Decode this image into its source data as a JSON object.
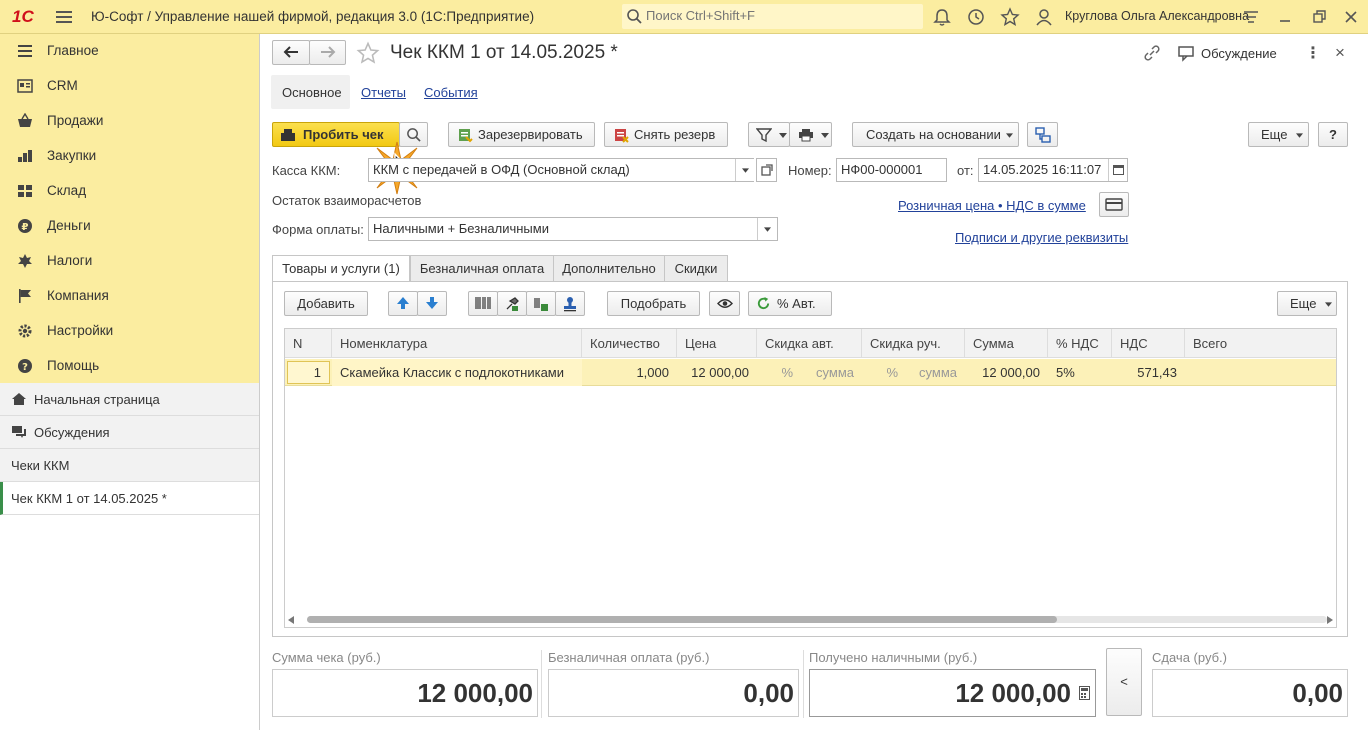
{
  "titlebar": {
    "logo": "1С",
    "title": "Ю-Софт / Управление нашей фирмой, редакция 3.0  (1С:Предприятие)",
    "search_placeholder": "Поиск Ctrl+Shift+F",
    "user": "Круглова Ольга Александровна"
  },
  "sidebar": {
    "sections": [
      {
        "label": "Главное",
        "icon": "menu-icon"
      },
      {
        "label": "CRM",
        "icon": "crm-icon"
      },
      {
        "label": "Продажи",
        "icon": "basket-icon"
      },
      {
        "label": "Закупки",
        "icon": "purchases-icon"
      },
      {
        "label": "Склад",
        "icon": "warehouse-icon"
      },
      {
        "label": "Деньги",
        "icon": "money-icon"
      },
      {
        "label": "Налоги",
        "icon": "taxes-icon"
      },
      {
        "label": "Компания",
        "icon": "flag-icon"
      },
      {
        "label": "Настройки",
        "icon": "gear-icon"
      },
      {
        "label": "Помощь",
        "icon": "help-icon"
      }
    ],
    "nav": [
      {
        "label": "Начальная страница",
        "icon": "home-icon"
      },
      {
        "label": "Обсуждения",
        "icon": "chat-icon"
      },
      {
        "label": "Чеки ККМ",
        "icon": ""
      },
      {
        "label": "Чек ККМ 1 от 14.05.2025 *",
        "icon": ""
      }
    ]
  },
  "doc": {
    "title": "Чек ККМ 1 от 14.05.2025 *",
    "discussion": "Обсуждение",
    "tabs_top": {
      "main": "Основное",
      "reports": "Отчеты",
      "events": "События"
    },
    "toolbar": {
      "print_check": "Пробить чек",
      "reserve": "Зарезервировать",
      "unreserve": "Снять резерв",
      "create_based": "Создать на основании",
      "more": "Еще",
      "help": "?"
    },
    "fields": {
      "kassa_label": "Касса ККМ:",
      "kassa_value": "ККМ с передачей в ОФД (Основной склад)",
      "number_label": "Номер:",
      "number_value": "НФ00-000001",
      "date_label": "от:",
      "date_value": "14.05.2025 16:11:07",
      "balance_label": "Остаток взаиморасчетов",
      "price_link": "Розничная цена • НДС в сумме",
      "signatures_link": "Подписи и другие реквизиты",
      "payment_label": "Форма оплаты:",
      "payment_value": "Наличными + Безналичными"
    },
    "tabs": [
      "Товары и услуги (1)",
      "Безналичная оплата",
      "Дополнительно",
      "Скидки"
    ],
    "table_toolbar": {
      "add": "Добавить",
      "pick": "Подобрать",
      "auto": "% Авт.",
      "more": "Еще"
    },
    "table": {
      "columns": [
        "N",
        "Номенклатура",
        "Количество",
        "Цена",
        "Скидка авт.",
        "Скидка руч.",
        "Сумма",
        "% НДС",
        "НДС",
        "Всего"
      ],
      "rows": [
        {
          "n": "1",
          "name": "Скамейка Классик с подлокотниками",
          "qty": "1,000",
          "price": "12 000,00",
          "auto_pct": "%",
          "auto_sum": "сумма",
          "man_pct": "%",
          "man_sum": "сумма",
          "sum": "12 000,00",
          "vat_rate": "5%",
          "vat": "571,43",
          "total": ""
        }
      ]
    },
    "totals": {
      "check_sum_label": "Сумма чека (руб.)",
      "check_sum": "12 000,00",
      "cashless_label": "Безналичная оплата (руб.)",
      "cashless": "0,00",
      "cash_label": "Получено наличными (руб.)",
      "cash": "12 000,00",
      "change_label": "Сдача (руб.)",
      "change": "0,00",
      "back_btn": "<"
    }
  }
}
